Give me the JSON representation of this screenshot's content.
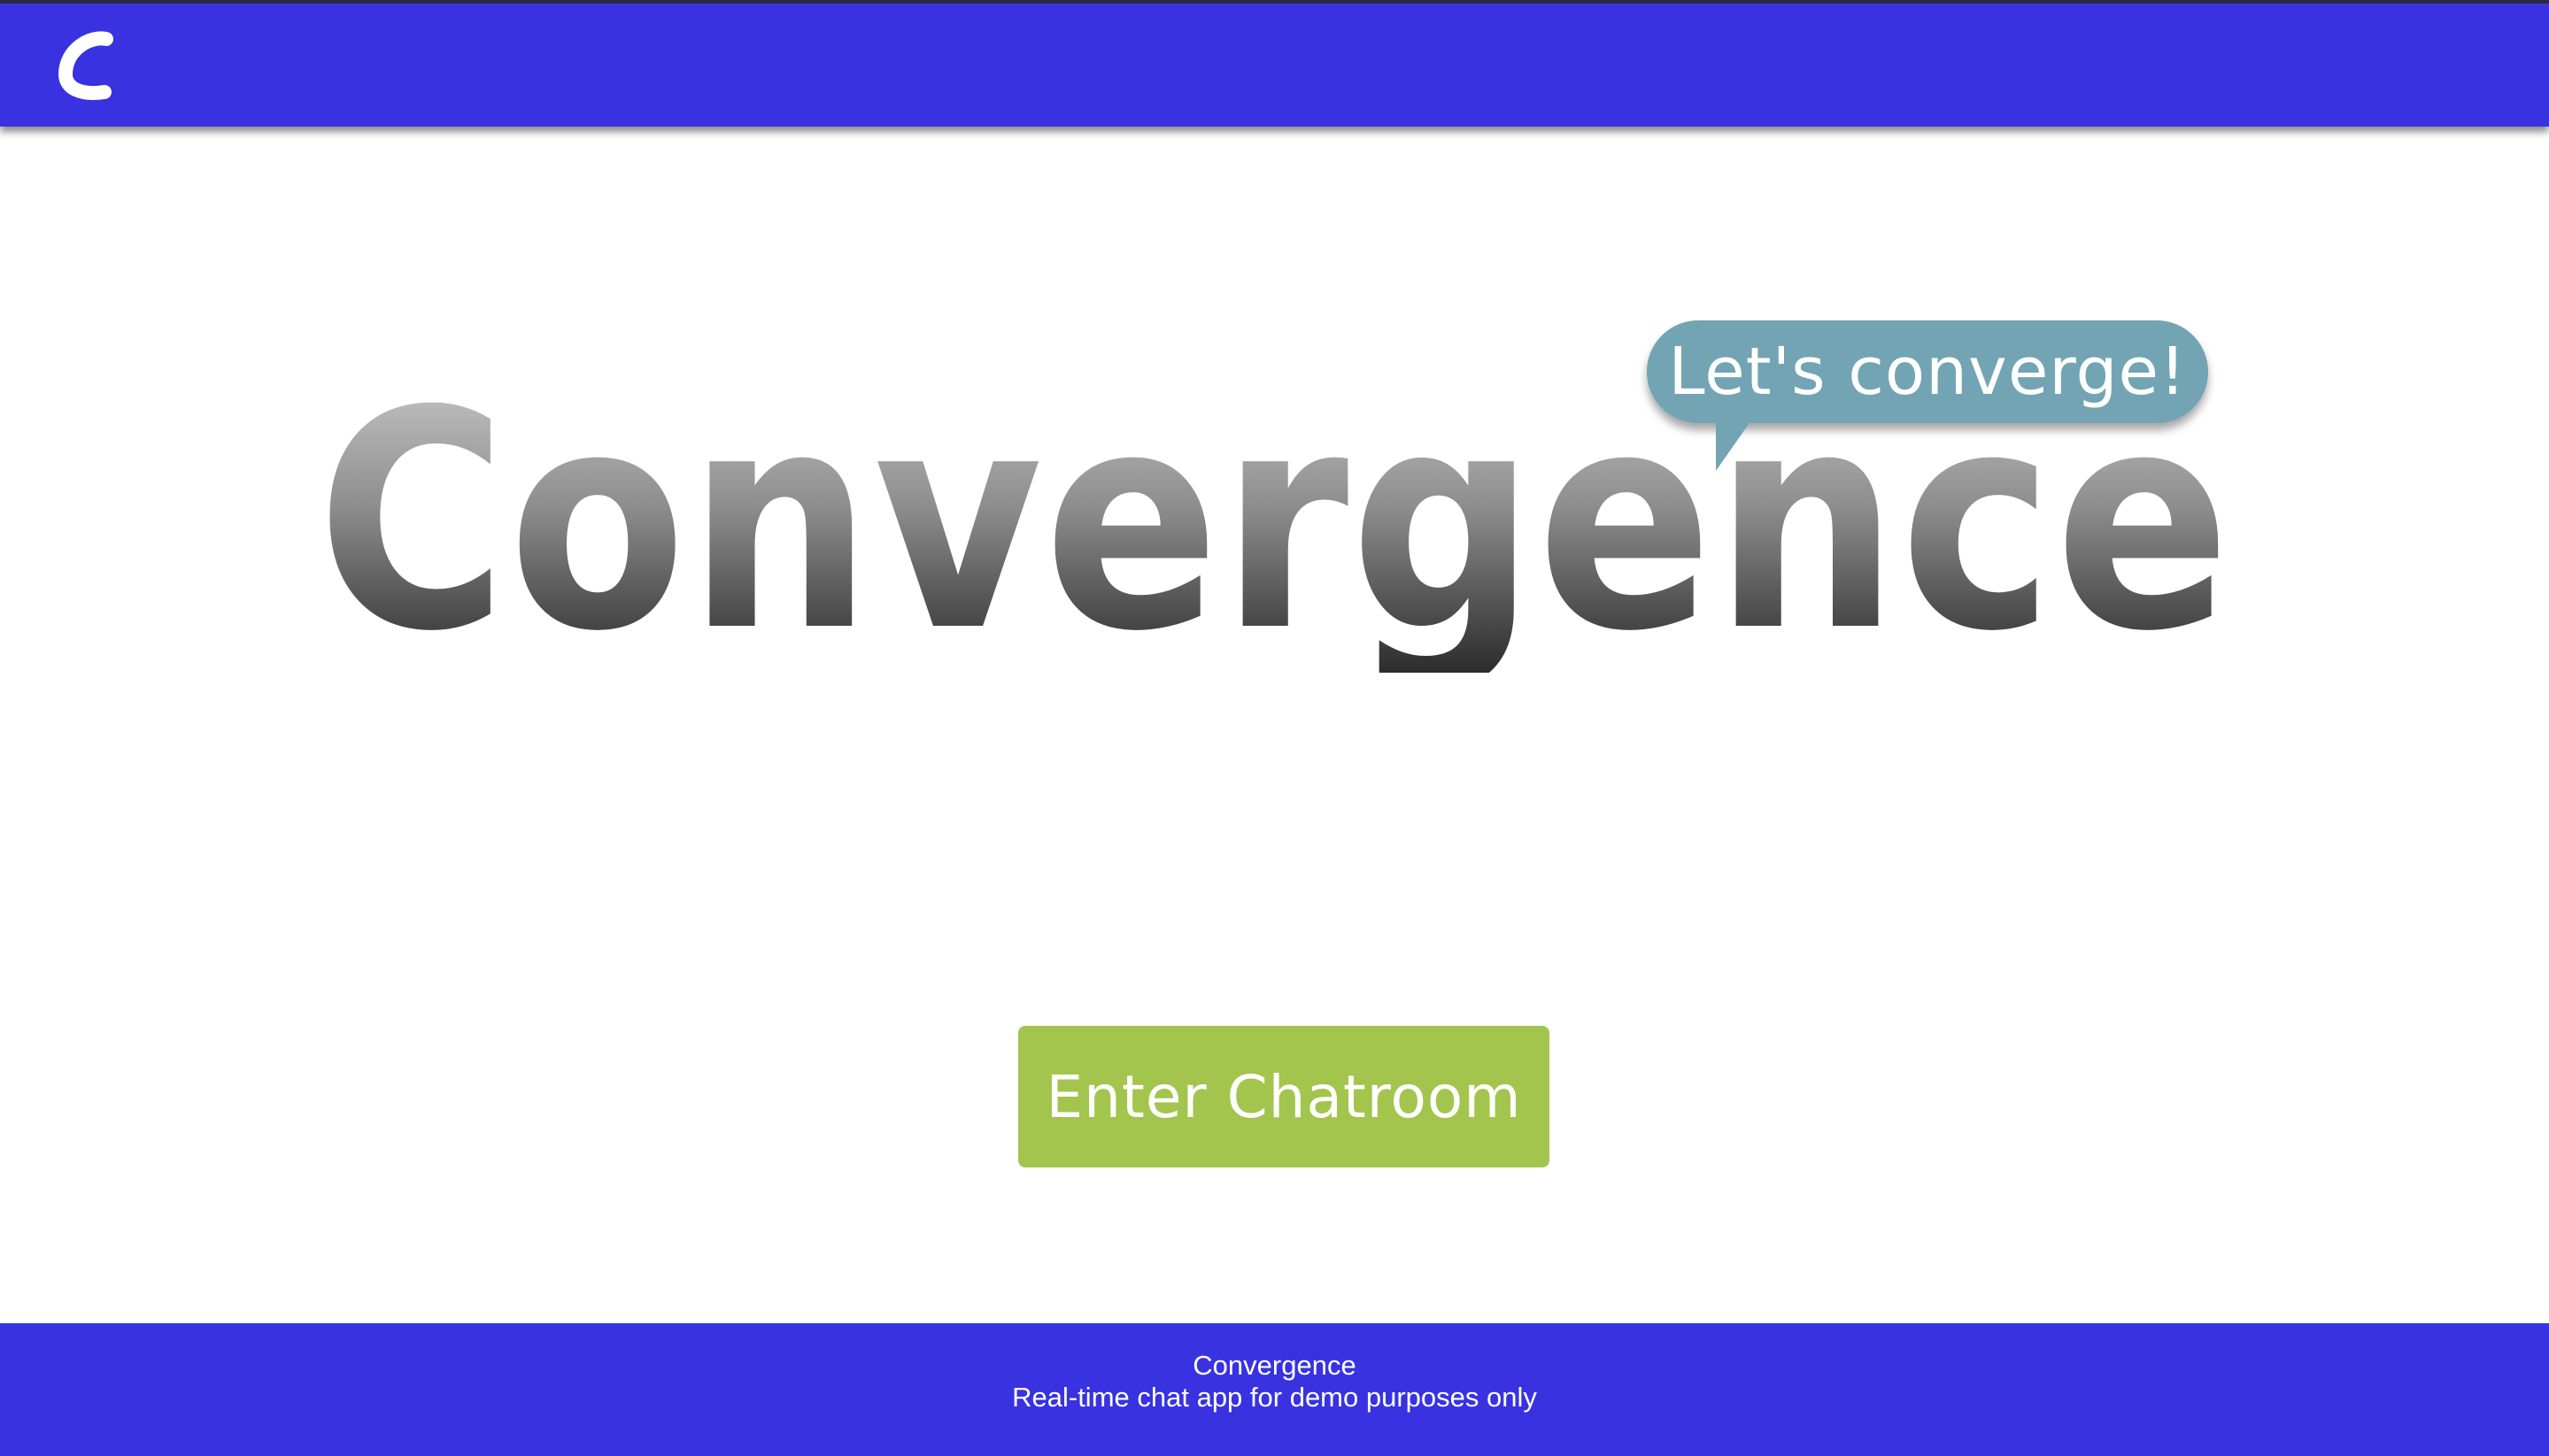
{
  "header": {
    "logo_icon": "c-logo-icon",
    "background_color": "#3832e1"
  },
  "hero": {
    "title": "Convergence",
    "bubble_text": "Let's converge!",
    "bubble_color": "#72a4b4"
  },
  "actions": {
    "enter_button_label": "Enter Chatroom",
    "enter_button_color": "#a3c54d"
  },
  "footer": {
    "title": "Convergence",
    "subtitle": "Real-time chat app for demo purposes only",
    "background_color": "#3832e1"
  }
}
